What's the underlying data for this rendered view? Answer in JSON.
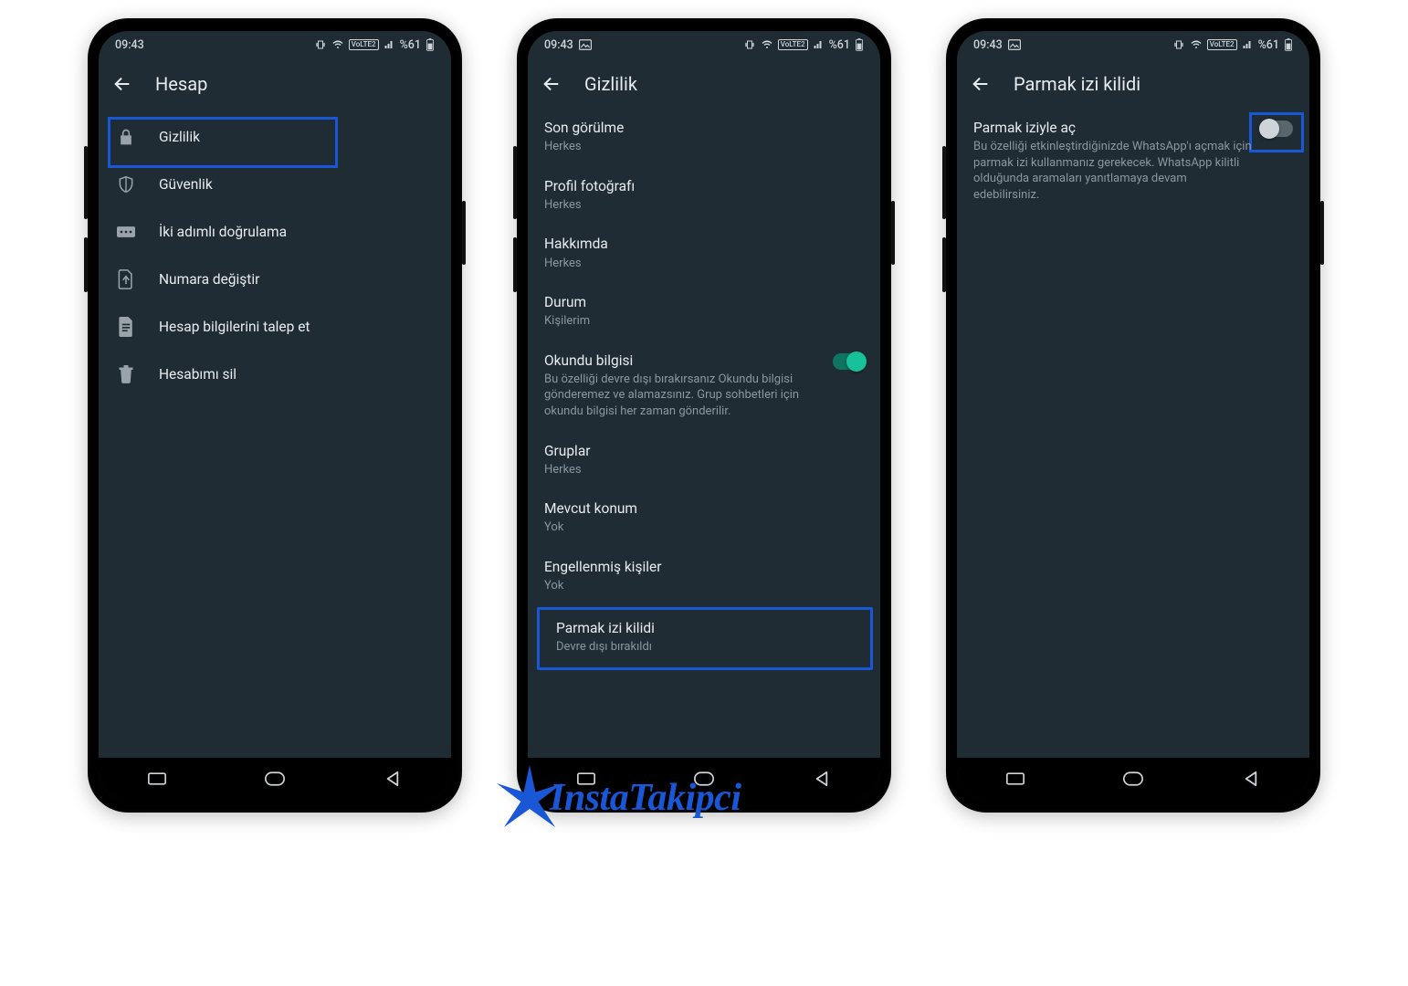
{
  "status": {
    "time": "09:43",
    "battery": "%61",
    "network_label": "VoLTE2",
    "has_gallery_icon": true
  },
  "phone1": {
    "title": "Hesap",
    "rows": [
      {
        "name": "gizlilik",
        "label": "Gizlilik",
        "icon": "lock",
        "highlight": true
      },
      {
        "name": "guvenlik",
        "label": "Güvenlik",
        "icon": "shield"
      },
      {
        "name": "iki-adimli",
        "label": "İki adımlı doğrulama",
        "icon": "dots"
      },
      {
        "name": "numara-degistir",
        "label": "Numara değiştir",
        "icon": "sim"
      },
      {
        "name": "hesap-bilgi",
        "label": "Hesap bilgilerini talep et",
        "icon": "file"
      },
      {
        "name": "hesabimi-sil",
        "label": "Hesabımı sil",
        "icon": "trash"
      }
    ]
  },
  "phone2": {
    "title": "Gizlilik",
    "prefs": [
      {
        "name": "son-gorulme",
        "title": "Son görülme",
        "sub": "Herkes"
      },
      {
        "name": "profil-foto",
        "title": "Profil fotoğrafı",
        "sub": "Herkes"
      },
      {
        "name": "hakkimda",
        "title": "Hakkımda",
        "sub": "Herkes"
      },
      {
        "name": "durum",
        "title": "Durum",
        "sub": "Kişilerim"
      },
      {
        "name": "okundu",
        "title": "Okundu bilgisi",
        "sub": "Bu özelliği devre dışı bırakırsanız Okundu bilgisi gönderemez ve alamazsınız. Grup sohbetleri için okundu bilgisi her zaman gönderilir.",
        "toggle": "on"
      },
      {
        "name": "gruplar",
        "title": "Gruplar",
        "sub": "Herkes"
      },
      {
        "name": "mevcut-konum",
        "title": "Mevcut konum",
        "sub": "Yok"
      },
      {
        "name": "engellenmis",
        "title": "Engellenmiş kişiler",
        "sub": "Yok"
      },
      {
        "name": "parmak-izi",
        "title": "Parmak izi kilidi",
        "sub": "Devre dışı bırakıldı",
        "highlight": true
      }
    ]
  },
  "phone3": {
    "title": "Parmak izi kilidi",
    "pref": {
      "title": "Parmak iziyle aç",
      "sub": "Bu özelliği etkinleştirdiğinizde WhatsApp'ı açmak için parmak izi kullanmanız gerekecek. WhatsApp kilitli olduğunda aramaları yanıtlamaya devam edebilirsiniz.",
      "toggle": "off",
      "highlight_toggle": true
    }
  },
  "watermark": "InstaTakipci"
}
